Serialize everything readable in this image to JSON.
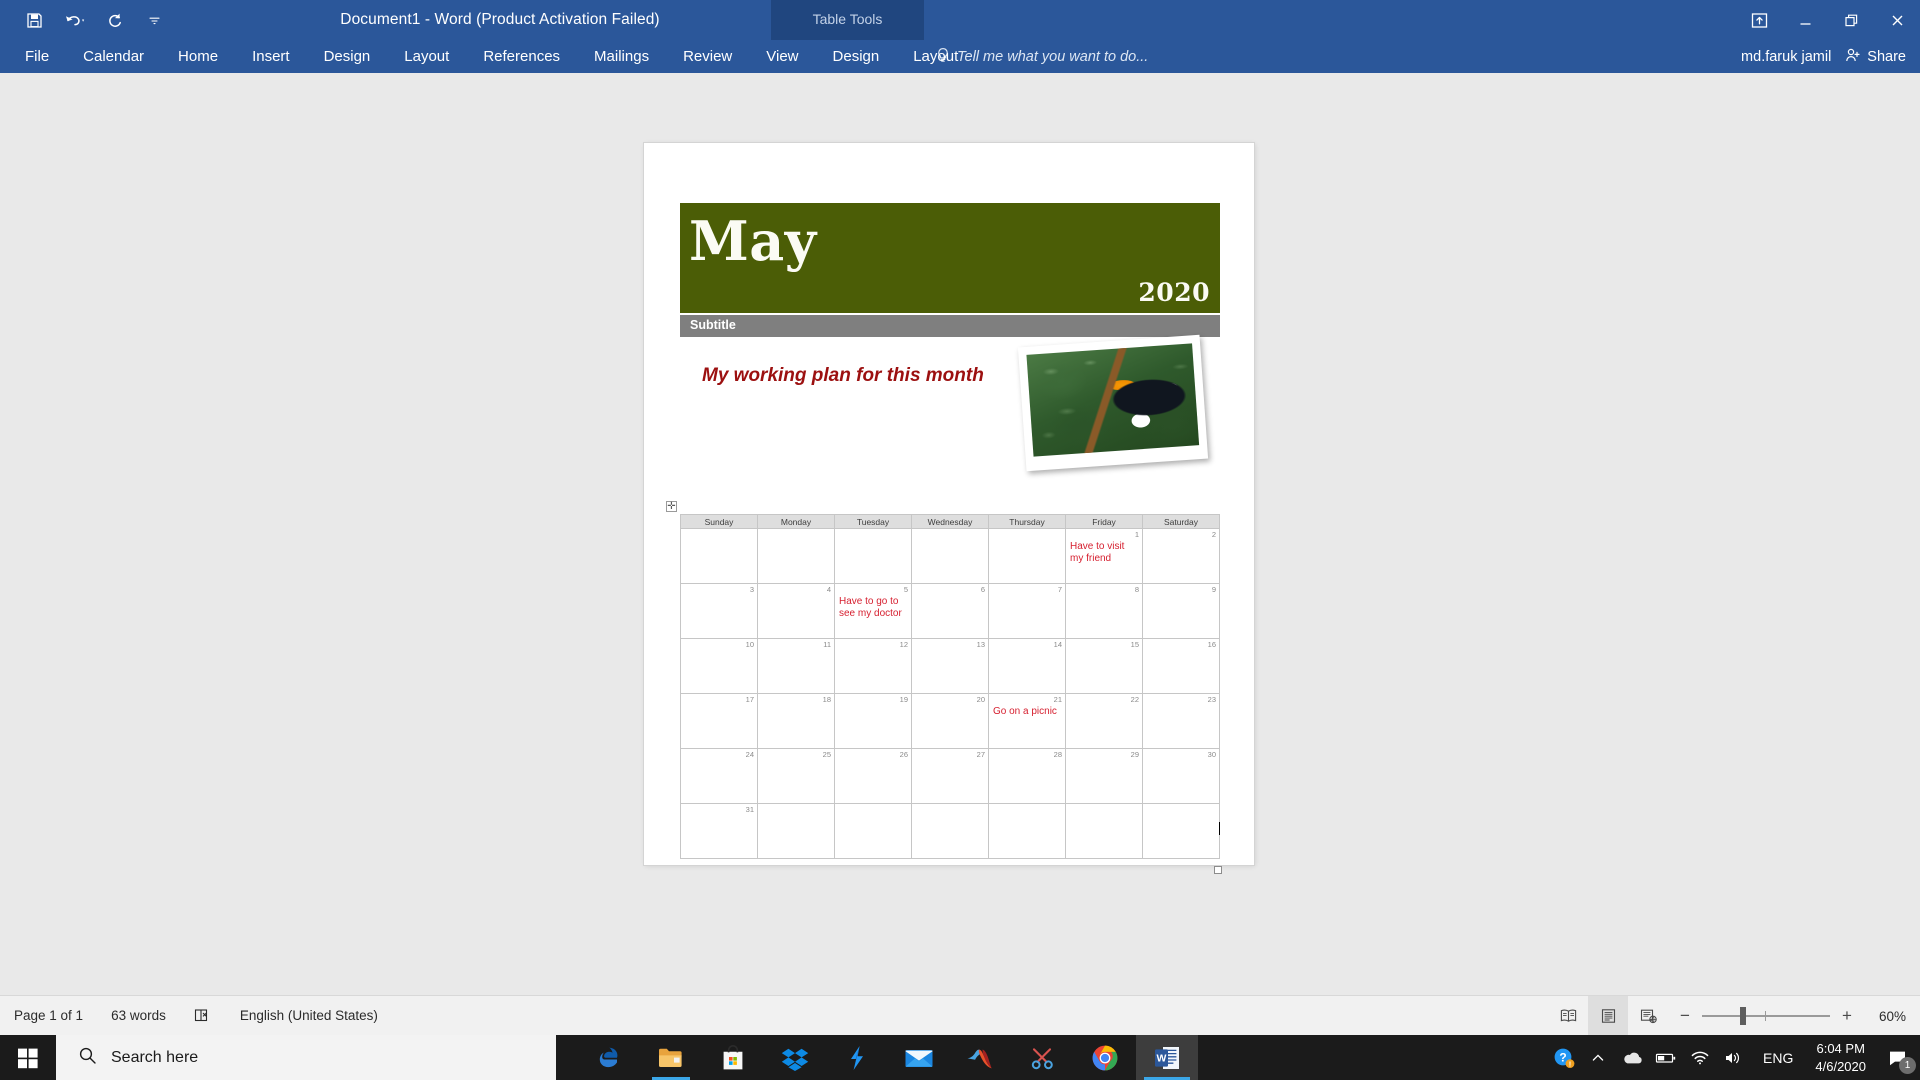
{
  "titlebar": {
    "document_title": "Document1 - Word (Product Activation Failed)",
    "contextual_group": "Table Tools",
    "quick_access": [
      {
        "name": "save-icon",
        "label": "Save"
      },
      {
        "name": "undo-icon",
        "label": "Undo"
      },
      {
        "name": "redo-icon",
        "label": "Redo"
      },
      {
        "name": "customize-qat-icon",
        "label": "Customize Quick Access Toolbar"
      }
    ],
    "window_buttons": [
      {
        "name": "ribbon-display-options-icon",
        "label": "Ribbon Display Options"
      },
      {
        "name": "minimize-icon",
        "label": "Minimize"
      },
      {
        "name": "restore-icon",
        "label": "Restore Down"
      },
      {
        "name": "close-icon",
        "label": "Close"
      }
    ]
  },
  "ribbon": {
    "tabs": [
      "File",
      "Calendar",
      "Home",
      "Insert",
      "Design",
      "Layout",
      "References",
      "Mailings",
      "Review",
      "View"
    ],
    "contextual_tabs": [
      "Design",
      "Layout"
    ],
    "tell_me_placeholder": "Tell me what you want to do...",
    "user_name": "md.faruk jamil",
    "share_label": "Share"
  },
  "document": {
    "banner": {
      "month": "May",
      "year": "2020",
      "bg_color": "#4b5d06",
      "text_color": "#fbfbf4"
    },
    "subtitle": {
      "text": "Subtitle",
      "bg_color": "#7f7f7f"
    },
    "heading": {
      "text": "My working plan for this month",
      "color": "#9c1010"
    },
    "photo": {
      "alt": "toucan perched on a branch in green foliage"
    },
    "calendar": {
      "day_headers": [
        "Sunday",
        "Monday",
        "Tuesday",
        "Wednesday",
        "Thursday",
        "Friday",
        "Saturday"
      ],
      "event_color": "#d62030",
      "weeks": [
        [
          {
            "day": "",
            "event": ""
          },
          {
            "day": "",
            "event": ""
          },
          {
            "day": "",
            "event": ""
          },
          {
            "day": "",
            "event": ""
          },
          {
            "day": "",
            "event": ""
          },
          {
            "day": "1",
            "event": "Have to visit my friend"
          },
          {
            "day": "2",
            "event": ""
          }
        ],
        [
          {
            "day": "3",
            "event": ""
          },
          {
            "day": "4",
            "event": ""
          },
          {
            "day": "5",
            "event": "Have to go to see my doctor"
          },
          {
            "day": "6",
            "event": ""
          },
          {
            "day": "7",
            "event": ""
          },
          {
            "day": "8",
            "event": ""
          },
          {
            "day": "9",
            "event": ""
          }
        ],
        [
          {
            "day": "10",
            "event": ""
          },
          {
            "day": "11",
            "event": ""
          },
          {
            "day": "12",
            "event": ""
          },
          {
            "day": "13",
            "event": ""
          },
          {
            "day": "14",
            "event": ""
          },
          {
            "day": "15",
            "event": ""
          },
          {
            "day": "16",
            "event": ""
          }
        ],
        [
          {
            "day": "17",
            "event": ""
          },
          {
            "day": "18",
            "event": ""
          },
          {
            "day": "19",
            "event": ""
          },
          {
            "day": "20",
            "event": ""
          },
          {
            "day": "21",
            "event": "Go on a picnic"
          },
          {
            "day": "22",
            "event": ""
          },
          {
            "day": "23",
            "event": ""
          }
        ],
        [
          {
            "day": "24",
            "event": ""
          },
          {
            "day": "25",
            "event": ""
          },
          {
            "day": "26",
            "event": ""
          },
          {
            "day": "27",
            "event": ""
          },
          {
            "day": "28",
            "event": ""
          },
          {
            "day": "29",
            "event": ""
          },
          {
            "day": "30",
            "event": ""
          }
        ],
        [
          {
            "day": "31",
            "event": ""
          },
          {
            "day": "",
            "event": ""
          },
          {
            "day": "",
            "event": ""
          },
          {
            "day": "",
            "event": ""
          },
          {
            "day": "",
            "event": ""
          },
          {
            "day": "",
            "event": ""
          },
          {
            "day": "",
            "event": ""
          }
        ]
      ]
    }
  },
  "statusbar": {
    "page_info": "Page 1 of 1",
    "word_count": "63 words",
    "proofing_icon": "proofing-errors-icon",
    "language": "English (United States)",
    "view_buttons": [
      {
        "name": "read-mode-icon",
        "label": "Read Mode",
        "active": false
      },
      {
        "name": "print-layout-icon",
        "label": "Print Layout",
        "active": true
      },
      {
        "name": "web-layout-icon",
        "label": "Web Layout",
        "active": false
      }
    ],
    "zoom_out": "−",
    "zoom_in": "+",
    "zoom_level": "60%"
  },
  "taskbar": {
    "start_label": "Start",
    "search_placeholder": "Search here",
    "apps": [
      {
        "name": "edge-icon",
        "label": "Microsoft Edge"
      },
      {
        "name": "file-explorer-icon",
        "label": "File Explorer"
      },
      {
        "name": "microsoft-store-icon",
        "label": "Microsoft Store"
      },
      {
        "name": "dropbox-icon",
        "label": "Dropbox"
      },
      {
        "name": "lightning-app-icon",
        "label": "App"
      },
      {
        "name": "mail-icon",
        "label": "Mail"
      },
      {
        "name": "matlab-icon",
        "label": "MATLAB"
      },
      {
        "name": "snipping-tool-icon",
        "label": "Snipping Tool"
      },
      {
        "name": "chrome-icon",
        "label": "Google Chrome"
      },
      {
        "name": "word-icon",
        "label": "Microsoft Word"
      }
    ],
    "tray": {
      "help_icon": "help-icon",
      "show_hidden_icon": "chevron-up-icon",
      "onedrive_icon": "onedrive-icon",
      "battery_icon": "battery-icon",
      "network_icon": "wifi-icon",
      "volume_icon": "speaker-icon",
      "language": "ENG",
      "time": "6:04 PM",
      "date": "4/6/2020",
      "notification_count": "1"
    }
  }
}
